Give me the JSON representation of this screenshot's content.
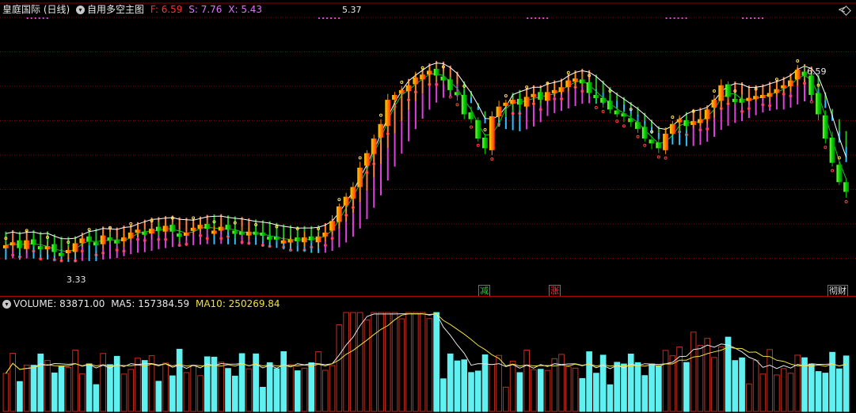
{
  "header": {
    "title": "皇庭国际 (日线)",
    "indicator_name": "自用多空主图",
    "f_label": "F: 6.59",
    "s_label": "S: 7.76",
    "x_label": "X: 5.43",
    "colors": {
      "title": "#e8e8e8",
      "f": "#ff3030",
      "s": "#e070ff",
      "x": "#e070ff"
    }
  },
  "price_pane": {
    "high_annotation": "5.37",
    "low_annotation": "3.33",
    "right_annotation": "6.59",
    "signal_tags": [
      {
        "text": "减",
        "color": "#28d028",
        "index": 68
      },
      {
        "text": "涨",
        "color": "#ff3b3b",
        "index": 79
      },
      {
        "text": "彻财",
        "color": "#e6e6e6",
        "index": 119
      }
    ]
  },
  "volume_pane": {
    "volume_label": "VOLUME: 83871.00",
    "ma5_label": "MA5: 157384.59",
    "ma10_label": "MA10: 250269.84",
    "colors": {
      "volume": "#e8e8e8",
      "ma5": "#e8e8e8",
      "ma10": "#f0e040"
    }
  },
  "colors": {
    "up": "#ff8000",
    "down": "#00e000",
    "grid": "#8b0000",
    "ribbon_up": "#ff8040",
    "ribbon_mid": "#e040e0",
    "ribbon_down": "#30c0ff",
    "ribbon_green": "#28b828",
    "vol_up": "#c03020",
    "vol_down": "#60f0f0"
  },
  "chart_data": [
    {
      "type": "candlestick",
      "price_range": [
        3.0,
        5.8
      ],
      "bars": 122,
      "closes": [
        3.45,
        3.48,
        3.42,
        3.5,
        3.46,
        3.41,
        3.44,
        3.38,
        3.36,
        3.4,
        3.47,
        3.52,
        3.49,
        3.45,
        3.55,
        3.5,
        3.47,
        3.53,
        3.58,
        3.61,
        3.57,
        3.62,
        3.6,
        3.65,
        3.59,
        3.55,
        3.58,
        3.63,
        3.66,
        3.62,
        3.6,
        3.64,
        3.61,
        3.58,
        3.57,
        3.59,
        3.56,
        3.55,
        3.53,
        3.52,
        3.5,
        3.51,
        3.49,
        3.53,
        3.5,
        3.54,
        3.58,
        3.7,
        3.85,
        3.95,
        4.05,
        4.25,
        4.4,
        4.55,
        4.7,
        4.95,
        5.0,
        5.05,
        5.1,
        5.18,
        5.21,
        5.25,
        5.2,
        5.15,
        5.05,
        5.0,
        4.8,
        4.75,
        4.55,
        4.45,
        4.78,
        4.88,
        4.92,
        4.95,
        4.9,
        4.98,
        5.01,
        4.95,
        5.03,
        5.05,
        5.08,
        5.15,
        5.17,
        5.12,
        5.02,
        4.97,
        4.92,
        4.85,
        4.8,
        4.78,
        4.72,
        4.65,
        4.55,
        4.5,
        4.45,
        4.6,
        4.7,
        4.75,
        4.68,
        4.73,
        4.75,
        4.85,
        4.95,
        5.1,
        4.98,
        4.96,
        4.92,
        4.97,
        4.99,
        5.0,
        5.02,
        5.06,
        5.1,
        5.15,
        5.26,
        5.2,
        5.0,
        4.8,
        4.55,
        4.3,
        4.1,
        4.0
      ],
      "ma_fast_label": "F",
      "ma_slow_label": "S"
    },
    {
      "type": "bar",
      "name": "VOLUME",
      "ma_labels": [
        "MA5",
        "MA10"
      ]
    }
  ]
}
